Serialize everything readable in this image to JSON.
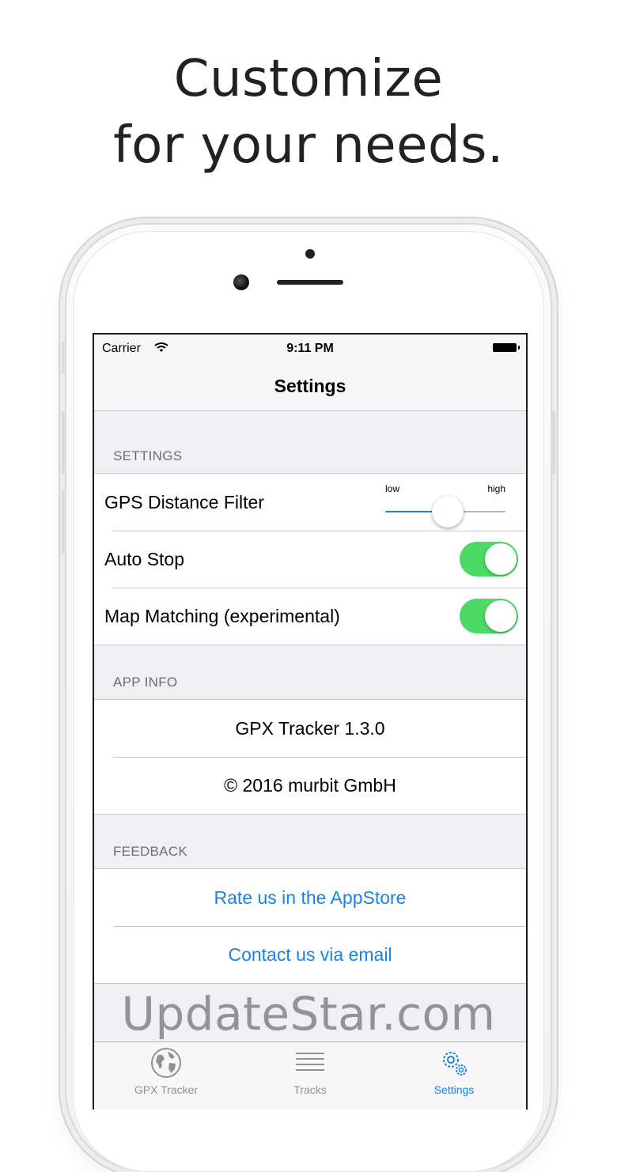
{
  "headline": {
    "line1": "Customize",
    "line2": "for your needs."
  },
  "status_bar": {
    "carrier": "Carrier",
    "time": "9:11 PM"
  },
  "nav": {
    "title": "Settings"
  },
  "sections": {
    "settings": {
      "header": "SETTINGS",
      "gps_label": "GPS Distance Filter",
      "slider_low": "low",
      "slider_high": "high",
      "slider_value": 0.52,
      "auto_stop_label": "Auto Stop",
      "auto_stop_on": true,
      "map_matching_label": "Map Matching (experimental)",
      "map_matching_on": true
    },
    "app_info": {
      "header": "APP INFO",
      "version": "GPX Tracker 1.3.0",
      "copyright": "© 2016 murbit GmbH"
    },
    "feedback": {
      "header": "FEEDBACK",
      "rate": "Rate us in the AppStore",
      "contact": "Contact us via email"
    }
  },
  "tabbar": {
    "tabs": [
      {
        "label": "GPX Tracker",
        "icon": "globe-icon",
        "active": false
      },
      {
        "label": "Tracks",
        "icon": "list-icon",
        "active": false
      },
      {
        "label": "Settings",
        "icon": "gears-icon",
        "active": true
      }
    ]
  },
  "colors": {
    "accent": "#1a82e2",
    "toggle_on": "#4cd964",
    "section_header": "#6d6d72"
  },
  "watermark": "UpdateStar.com"
}
